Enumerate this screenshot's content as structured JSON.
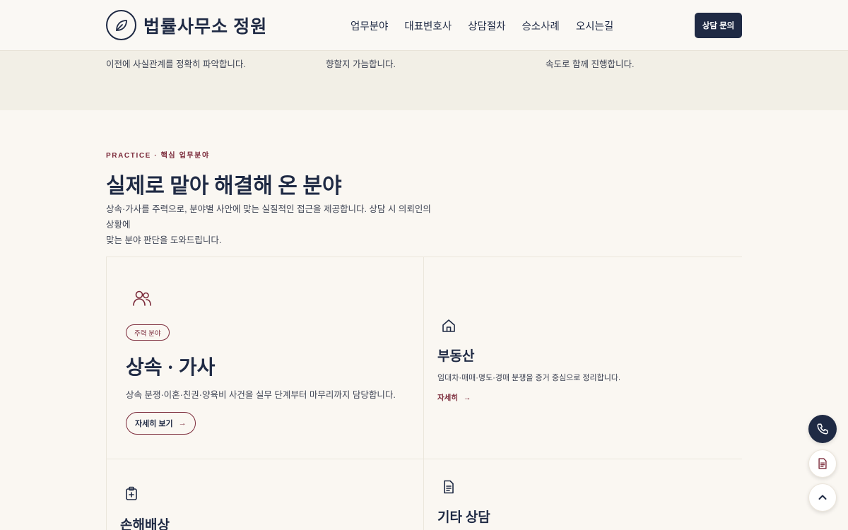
{
  "header": {
    "logo_text": "법률사무소 정원",
    "nav": [
      "업무분야",
      "대표변호사",
      "상담절차",
      "승소사례",
      "오시는길"
    ],
    "cta_label": "상담 문의"
  },
  "band": {
    "columns": [
      {
        "line2": "이전에 사실관계를 정확히 파악합니다."
      },
      {
        "line2": "향할지 가늠합니다."
      },
      {
        "line2": "속도로 함께 진행합니다."
      }
    ]
  },
  "section": {
    "eyebrow": "PRACTICE · 핵심 업무분야",
    "title": "실제로 맡아 해결해 온 분야",
    "desc_line1": "상속·가사를 주력으로, 분야별 사안에 맞는 실질적인 접근을 제공합니다. 상담 시 의뢰인의 상황에",
    "desc_line2": "맞는 분야 판단을 도와드립니다."
  },
  "cards": [
    {
      "icon": "people-icon",
      "badge": "주력 분야",
      "title": "상속 · 가사",
      "desc": "상속 분쟁·이혼·친권·양육비 사건을 실무 단계부터 마무리까지 담당합니다.",
      "more": "자세히 보기",
      "arrow": "→"
    },
    {
      "icon": "house-icon",
      "title": "부동산",
      "desc": "임대차·매매·명도·경매 분쟁을 증거 중심으로 정리합니다.",
      "more": "자세히",
      "arrow": "→"
    },
    {
      "icon": "medical-clipboard-icon",
      "title": "손해배상"
    },
    {
      "icon": "document-icon",
      "title": "기타 상담"
    }
  ],
  "colors": {
    "navy": "#1f2a44",
    "burgundy": "#7b2a3a",
    "bg": "#faf7f2",
    "band": "#f2efe6"
  },
  "fabs": [
    "phone-icon",
    "document-icon",
    "chevron-up-icon"
  ]
}
